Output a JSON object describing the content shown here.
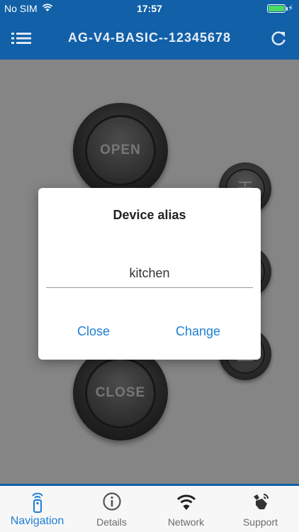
{
  "status_bar": {
    "carrier": "No SIM",
    "time": "17:57",
    "battery_color": "#4cd964"
  },
  "app_bar": {
    "title": "AG-V4-BASIC--12345678",
    "menu_icon": "hamburger-menu-icon",
    "refresh_icon": "refresh-icon",
    "background": "#1160a8"
  },
  "controls": {
    "open_label": "OPEN",
    "close_label": "CLOSE"
  },
  "dialog": {
    "title": "Device alias",
    "input_value": "kitchen",
    "close_label": "Close",
    "change_label": "Change",
    "accent": "#1e7fd6"
  },
  "tabs": [
    {
      "label": "Navigation",
      "icon": "remote-control-icon",
      "active": true
    },
    {
      "label": "Details",
      "icon": "info-icon",
      "active": false
    },
    {
      "label": "Network",
      "icon": "wifi-icon",
      "active": false
    },
    {
      "label": "Support",
      "icon": "support-hand-icon",
      "active": false
    }
  ]
}
